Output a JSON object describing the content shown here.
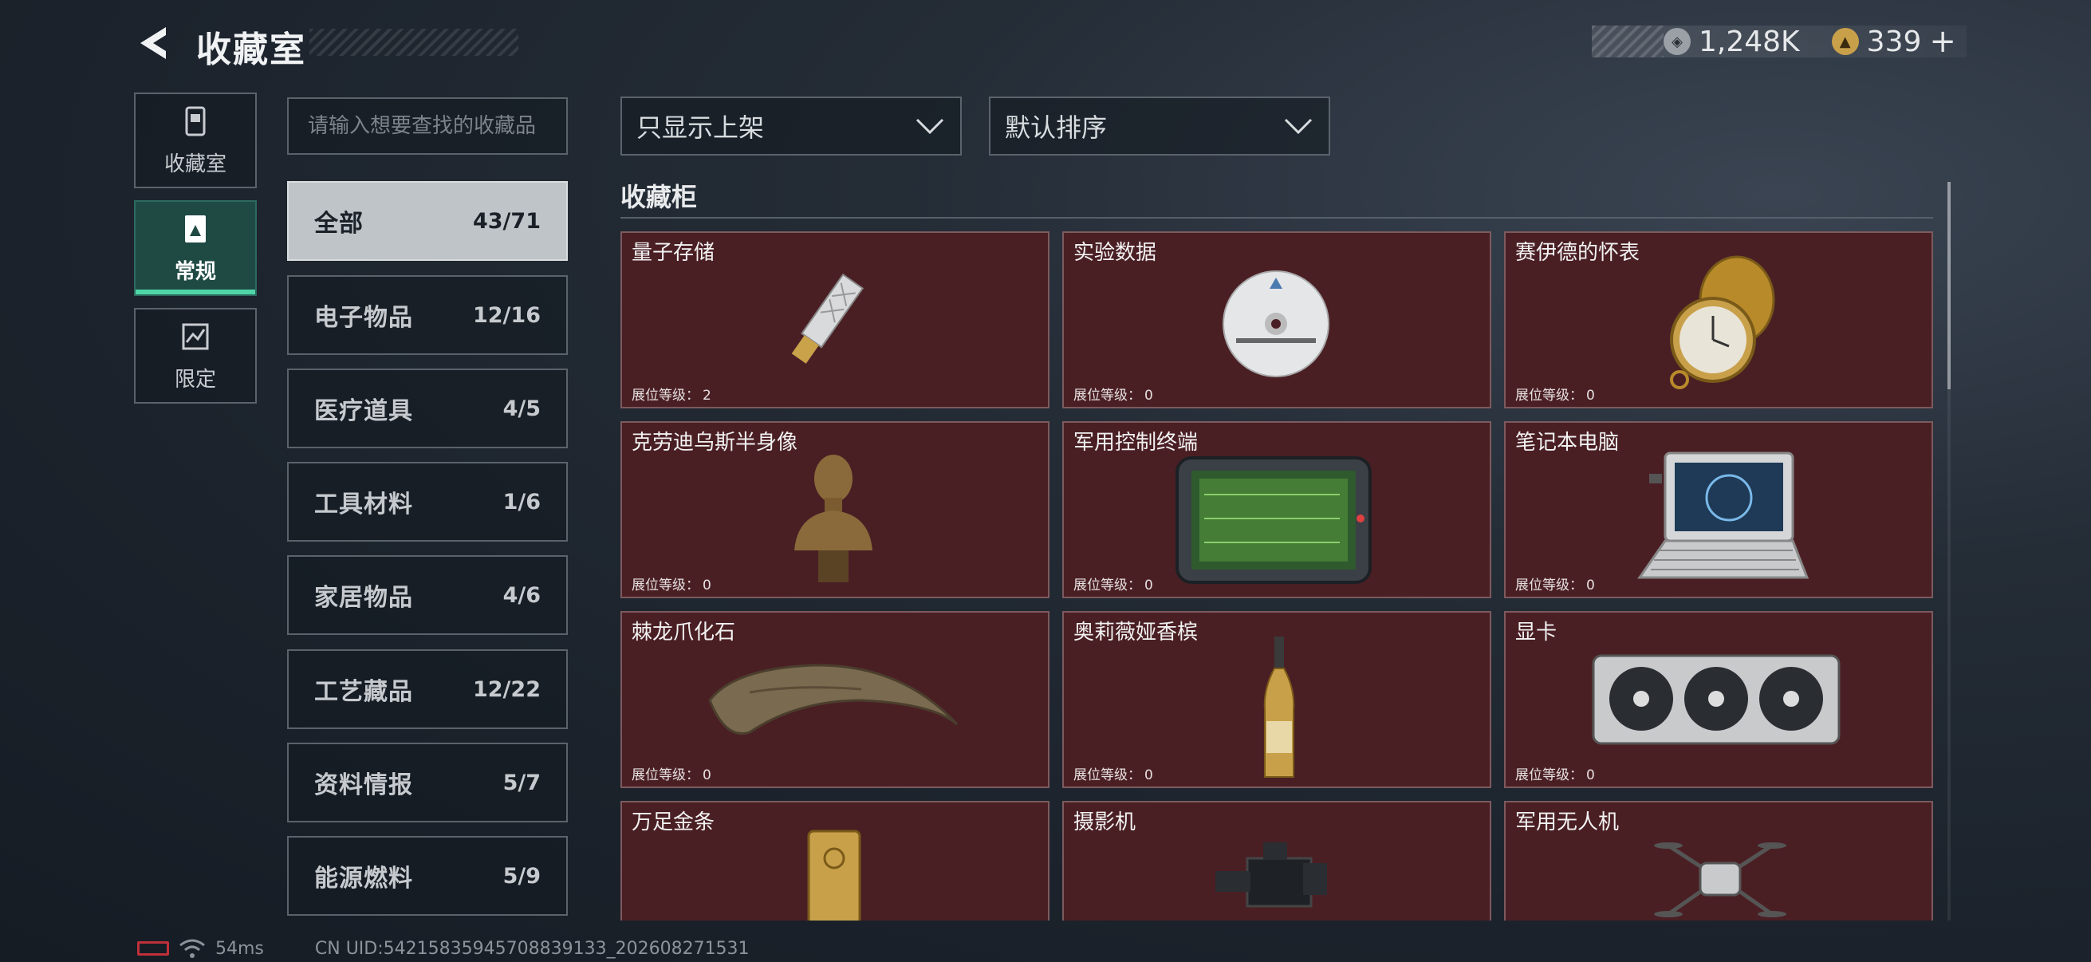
{
  "header": {
    "title": "收藏室"
  },
  "currency": {
    "silver": "1,248K",
    "gold": "339",
    "add_symbol": "+"
  },
  "rail": [
    {
      "label": "收藏室",
      "icon": "trash-bin-icon"
    },
    {
      "label": "常规",
      "icon": "document-icon"
    },
    {
      "label": "限定",
      "icon": "chart-icon"
    }
  ],
  "search": {
    "placeholder": "请输入想要查找的收藏品"
  },
  "categories": [
    {
      "name": "全部",
      "count": "43/71"
    },
    {
      "name": "电子物品",
      "count": "12/16"
    },
    {
      "name": "医疗道具",
      "count": "4/5"
    },
    {
      "name": "工具材料",
      "count": "1/6"
    },
    {
      "name": "家居物品",
      "count": "4/6"
    },
    {
      "name": "工艺藏品",
      "count": "12/22"
    },
    {
      "name": "资料情报",
      "count": "5/7"
    },
    {
      "name": "能源燃料",
      "count": "5/9"
    }
  ],
  "filters": {
    "display": "只显示上架",
    "sort": "默认排序"
  },
  "section": {
    "title": "收藏柜"
  },
  "level_label": "展位等级：",
  "items": [
    {
      "name": "量子存储",
      "level": "2"
    },
    {
      "name": "实验数据",
      "level": "0"
    },
    {
      "name": "赛伊德的怀表",
      "level": "0"
    },
    {
      "name": "克劳迪乌斯半身像",
      "level": "0"
    },
    {
      "name": "军用控制终端",
      "level": "0"
    },
    {
      "name": "笔记本电脑",
      "level": "0"
    },
    {
      "name": "棘龙爪化石",
      "level": "0"
    },
    {
      "name": "奥莉薇娅香槟",
      "level": "0"
    },
    {
      "name": "显卡",
      "level": "0"
    },
    {
      "name": "万足金条",
      "level": ""
    },
    {
      "name": "摄影机",
      "level": ""
    },
    {
      "name": "军用无人机",
      "level": ""
    }
  ],
  "footer": {
    "ping": "54ms",
    "uid": "CN UID:542158359457088391​33_202608271531"
  },
  "colors": {
    "card_bg": "#4a1f24",
    "accent_green": "#4fd6a8",
    "active_tab": "#1f4a44"
  }
}
